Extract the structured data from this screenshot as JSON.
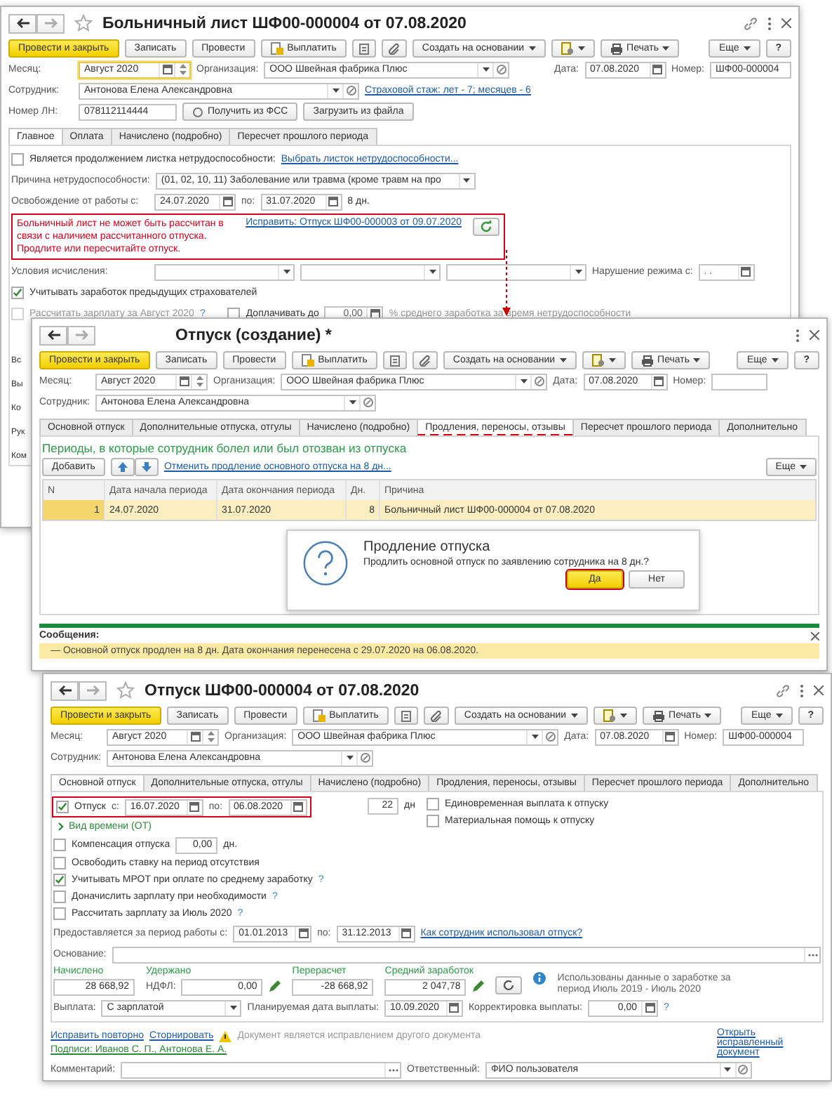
{
  "sick_leave": {
    "title": "Больничный лист ШФ00-000004 от 07.08.2020",
    "toolbar": [
      {
        "kind": "primary",
        "label": "Провести и закрыть"
      },
      {
        "kind": "plain",
        "label": "Записать"
      },
      {
        "kind": "plain",
        "label": "Провести"
      },
      {
        "kind": "pay",
        "label": "Выплатить"
      },
      {
        "kind": "docs"
      },
      {
        "kind": "clip"
      },
      {
        "kind": "menu",
        "label": "Создать на основании"
      },
      {
        "kind": "reports"
      },
      {
        "kind": "print",
        "label": "Печать"
      },
      {
        "kind": "menu",
        "label": "Еще"
      },
      {
        "kind": "help",
        "label": "?"
      }
    ],
    "month": {
      "label": "Месяц:",
      "value": "Август 2020"
    },
    "organization": {
      "label": "Организация:",
      "value": "ООО Швейная фабрика Плюс"
    },
    "date": {
      "label": "Дата:",
      "value": "07.08.2020"
    },
    "number": {
      "label": "Номер:",
      "value": "ШФ00-000004"
    },
    "employee": {
      "label": "Сотрудник:",
      "value": "Антонова Елена Александровна"
    },
    "insurance_link": "Страховой стаж: лет - 7; месяцев - 6",
    "ln_number": {
      "label": "Номер ЛН:",
      "value": "078112114444"
    },
    "ln_buttons": [
      "Получить из ФСС",
      "Загрузить из файла"
    ],
    "tabs": [
      {
        "label": "Главное",
        "selected": true
      },
      {
        "label": "Оплата",
        "selected": false
      },
      {
        "label": "Начислено (подробно)",
        "selected": false
      },
      {
        "label": "Пересчет прошлого периода",
        "selected": false
      }
    ],
    "continuation": {
      "label": "Является продолжением листка нетрудоспособности:",
      "checked": false,
      "link": "Выбрать листок нетрудоспособности..."
    },
    "reason": {
      "label": "Причина нетрудоспособности:",
      "value": "(01, 02, 10, 11) Заболевание или травма (кроме травм на про"
    },
    "release": {
      "label": "Освобождение от работы с:",
      "from": "24.07.2020",
      "to_label": "по:",
      "to": "31.07.2020",
      "days": "8 дн."
    },
    "error": {
      "text": "Больничный лист не может быть рассчитан в связи с наличием рассчитанного отпуска. Продлите или пересчитайте отпуск.",
      "link": "Исправить: Отпуск ШФ00-000003 от 09.07.2020"
    },
    "conditions": {
      "label": "Условия исчисления:",
      "violation_label": "Нарушение режима с:",
      "violation_value": ". ."
    },
    "prev_insurers": {
      "label": "Учитывать заработок предыдущих страхователей",
      "checked": true
    },
    "calc_salary": {
      "label": "Рассчитать зарплату за Август 2020",
      "checked": false,
      "disabled": true,
      "hint": "?"
    },
    "top_up": {
      "label": "Доплачивать до",
      "checked": false,
      "value": "0,00",
      "suffix": "% среднего заработка за время нетрудоспособности"
    },
    "hidden_labels": [
      "Вс",
      "Вы",
      "Ко",
      "Рук",
      "Ком"
    ]
  },
  "vacation_new": {
    "title": "Отпуск (создание) *",
    "toolbar": [
      {
        "kind": "primary",
        "label": "Провести и закрыть"
      },
      {
        "kind": "plain",
        "label": "Записать"
      },
      {
        "kind": "plain",
        "label": "Провести"
      },
      {
        "kind": "pay",
        "label": "Выплатить"
      },
      {
        "kind": "docs"
      },
      {
        "kind": "clip"
      },
      {
        "kind": "menu",
        "label": "Создать на основании"
      },
      {
        "kind": "reports"
      },
      {
        "kind": "print",
        "label": "Печать"
      },
      {
        "kind": "menu",
        "label": "Еще"
      },
      {
        "kind": "help",
        "label": "?"
      }
    ],
    "month": {
      "label": "Месяц:",
      "value": "Август 2020"
    },
    "organization": {
      "label": "Организация:",
      "value": "ООО Швейная фабрика Плюс"
    },
    "date": {
      "label": "Дата:",
      "value": "07.08.2020"
    },
    "number": {
      "label": "Номер:"
    },
    "employee": {
      "label": "Сотрудник:",
      "value": "Антонова Елена Александровна"
    },
    "tabs": [
      {
        "label": "Основной отпуск",
        "selected": false
      },
      {
        "label": "Дополнительные отпуска, отгулы",
        "selected": false
      },
      {
        "label": "Начислено (подробно)",
        "selected": false
      },
      {
        "label": "Продления, переносы, отзывы",
        "selected": true
      },
      {
        "label": "Пересчет прошлого периода",
        "selected": false
      },
      {
        "label": "Дополнительно",
        "selected": false
      }
    ],
    "periods": {
      "title": "Периоды, в которые сотрудник болел или был отозван из отпуска",
      "add": "Добавить",
      "cancel_link": "Отменить продление основного отпуска на 8 дн...",
      "more": "Еще",
      "columns": [
        "N",
        "Дата начала периода",
        "Дата окончания периода",
        "Дн.",
        "Причина"
      ],
      "rows": [
        {
          "cells": [
            "1",
            "24.07.2020",
            "31.07.2020",
            "8",
            "Больничный лист ШФ00-000004 от 07.08.2020"
          ],
          "selected": true
        }
      ]
    },
    "dialog": {
      "title": "Продление отпуска",
      "text": "Продлить основной отпуск по заявлению сотрудника на 8 дн.?",
      "buttons": [
        {
          "label": "Да",
          "default": true
        },
        {
          "label": "Нет",
          "default": false
        }
      ]
    },
    "messages": {
      "title": "Сообщения:",
      "items": [
        "— Основной отпуск продлен на 8 дн. Дата окончания перенесена с 29.07.2020 на 06.08.2020."
      ]
    }
  },
  "vacation": {
    "title": "Отпуск ШФ00-000004 от 07.08.2020",
    "toolbar": [
      {
        "kind": "primary",
        "label": "Провести и закрыть"
      },
      {
        "kind": "plain",
        "label": "Записать"
      },
      {
        "kind": "plain",
        "label": "Провести"
      },
      {
        "kind": "pay",
        "label": "Выплатить"
      },
      {
        "kind": "docs"
      },
      {
        "kind": "clip"
      },
      {
        "kind": "menu",
        "label": "Создать на основании"
      },
      {
        "kind": "reports"
      },
      {
        "kind": "print",
        "label": "Печать"
      },
      {
        "kind": "menu",
        "label": "Еще"
      },
      {
        "kind": "help",
        "label": "?"
      }
    ],
    "month": {
      "label": "Месяц:",
      "value": "Август 2020"
    },
    "organization": {
      "label": "Организация:",
      "value": "ООО Швейная фабрика Плюс"
    },
    "date": {
      "label": "Дата:",
      "value": "07.08.2020"
    },
    "number": {
      "label": "Номер:",
      "value": "ШФ00-000004"
    },
    "employee": {
      "label": "Сотрудник:",
      "value": "Антонова Елена Александровна"
    },
    "tabs": [
      {
        "label": "Основной отпуск",
        "selected": true
      },
      {
        "label": "Дополнительные отпуска, отгулы",
        "selected": false
      },
      {
        "label": "Начислено (подробно)",
        "selected": false
      },
      {
        "label": "Продления, переносы, отзывы",
        "selected": false
      },
      {
        "label": "Пересчет прошлого периода",
        "selected": false
      },
      {
        "label": "Дополнительно",
        "selected": false
      }
    ],
    "vacation_row": {
      "label": "Отпуск",
      "checked": true,
      "from_label": "с:",
      "from": "16.07.2020",
      "to_label": "по:",
      "to": "06.08.2020",
      "days": "22",
      "days_unit": "дн"
    },
    "right_checks": [
      {
        "label": "Единовременная выплата к отпуску",
        "checked": false
      },
      {
        "label": "Материальная помощь к отпуску",
        "checked": false
      }
    ],
    "time_kind": "Вид времени (ОТ)",
    "compensation": {
      "label": "Компенсация отпуска",
      "checked": false,
      "value": "0,00",
      "unit": "дн."
    },
    "options": [
      {
        "label": "Освободить ставку на период отсутствия",
        "checked": false
      },
      {
        "label": "Учитывать МРОТ при оплате по среднему заработку",
        "checked": true,
        "hint": "?"
      },
      {
        "label": "Доначислить зарплату при необходимости",
        "checked": false,
        "hint": "?"
      },
      {
        "label": "Рассчитать зарплату за Июль 2020",
        "checked": false,
        "hint": "?"
      }
    ],
    "work_period": {
      "label": "Предоставляется за период работы с:",
      "from": "01.01.2013",
      "to_label": "по:",
      "to": "31.12.2013",
      "link": "Как сотрудник использовал отпуск?"
    },
    "basis": {
      "label": "Основание:"
    },
    "accrued": {
      "label": "Начислено",
      "value": "28 668,92"
    },
    "withheld": {
      "label": "Удержано",
      "sub_label": "НДФЛ:",
      "value": "0,00"
    },
    "recalc": {
      "label": "Перерасчет",
      "value": "-28 668,92"
    },
    "average": {
      "label": "Средний заработок",
      "value": "2 047,78"
    },
    "info": "Использованы данные о заработке за период Июль 2019 - Июль 2020",
    "payment": {
      "label": "Выплата:",
      "value": "С зарплатой"
    },
    "planned": {
      "label": "Планируемая дата выплаты:",
      "value": "10.09.2020"
    },
    "correction": {
      "label": "Корректировка выплаты:",
      "value": "0,00",
      "hint": "?"
    },
    "fix_again": "Исправить повторно",
    "reverse": "Сторнировать",
    "warning": "Документ является исправлением другого документа",
    "open_fixed": "Открыть исправленный документ",
    "signatures": "Подписи: Иванов С. П., Антонова Е. А.",
    "comment": {
      "label": "Комментарий:"
    },
    "responsible": {
      "label": "Ответственный:",
      "value": "ФИО пользователя"
    }
  }
}
